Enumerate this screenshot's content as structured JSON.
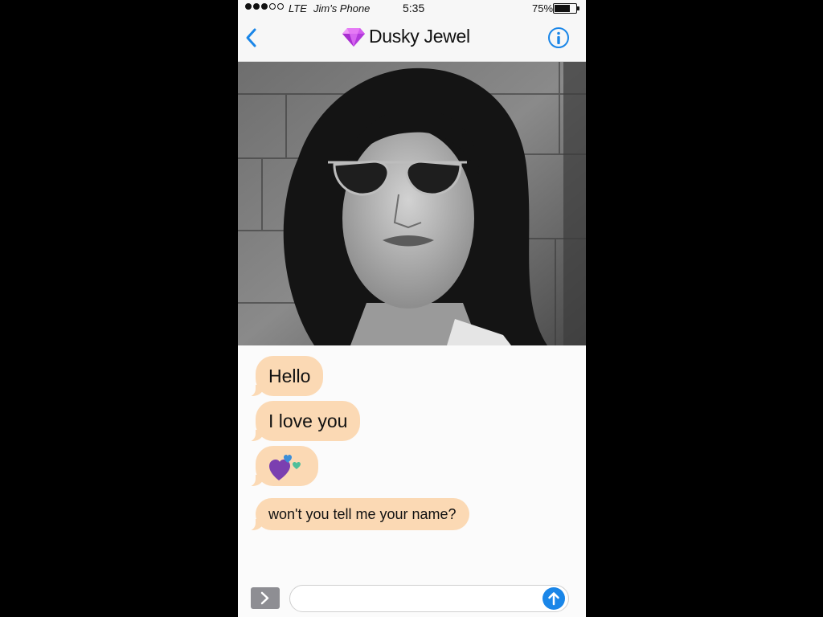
{
  "status_bar": {
    "carrier": "LTE",
    "device_name": "Jim's Phone",
    "time": "5:35",
    "battery_percent": "75%",
    "battery_level": 0.75,
    "signal_bars_filled": 3,
    "signal_bars_total": 5
  },
  "nav": {
    "contact_name": "Dusky Jewel",
    "contact_icon": "gem-icon",
    "back_icon": "chevron-left-icon",
    "info_icon": "info-icon",
    "accent_color": "#1a86e8"
  },
  "photo": {
    "description_icon": "contact-photo"
  },
  "messages": [
    {
      "text": "Hello"
    },
    {
      "text": "I love you"
    },
    {
      "text": "",
      "emoji": "hearts-icon"
    },
    {
      "text": "won't you tell me your name?"
    }
  ],
  "input_bar": {
    "placeholder": "",
    "expand_icon": "chevron-right-icon",
    "send_icon": "arrow-up-icon"
  },
  "colors": {
    "bubble": "#fbd9b4",
    "background": "#000000",
    "accent": "#1a86e8"
  }
}
